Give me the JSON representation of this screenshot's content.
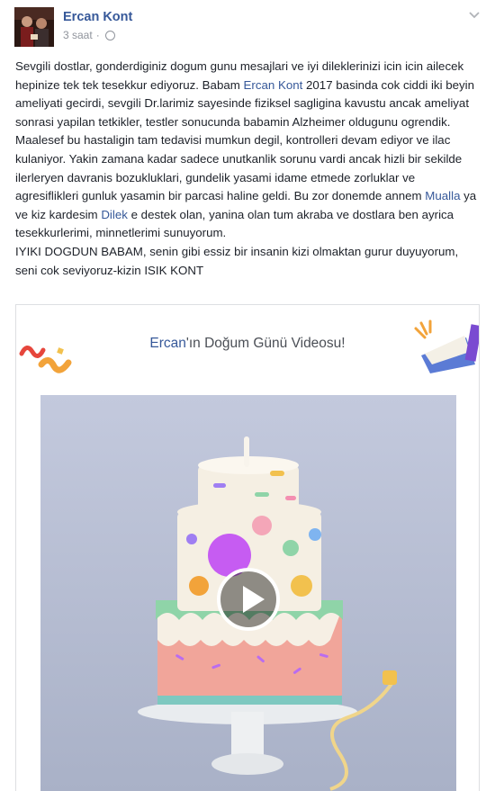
{
  "post": {
    "author": "Ercan Kont",
    "time": "3 saat",
    "time_separator": "·",
    "privacy_icon": "globe-icon",
    "options_icon": "chevron-down-icon",
    "paragraph": {
      "t1": "Sevgili dostlar, gonderdiginiz dogum gunu mesajlari ve iyi dileklerinizi icin icin ailecek hepinize tek tek tesekkur ediyoruz. Babam ",
      "mention_father": "Ercan Kont",
      "t2": " 2017 basinda cok ciddi iki beyin ameliyati gecirdi, sevgili Dr.larimiz sayesinde fiziksel sagligina kavustu ancak ameliyat sonrasi yapilan tetkikler, testler sonucunda babamin Alzheimer oldugunu ogrendik. Maalesef bu hastaligin tam tedavisi mumkun degil, kontrolleri devam ediyor ve ilac kulaniyor. Yakin zamana kadar sadece unutkanlik sorunu vardi ancak hizli bir sekilde ilerleryen davranis bozukluklari, gundelik yasami idame etmede zorluklar ve agresiflikleri gunluk yasamin bir parcasi haline geldi. Bu zor donemde annem ",
      "mention_mother": "Mualla",
      "t3": " ya ve kiz kardesim ",
      "mention_sister": "Dilek",
      "t4": " e destek olan, yanina olan tum akraba ve dostlara ben ayrica tesekkurlerimi, minnetlerimi sunuyorum.",
      "t5": "IYIKI DOGDUN BABAM, senin gibi essiz bir insanin kizi olmaktan gurur duyuyorum, seni cok seviyoruz-kizin ISIK KONT"
    }
  },
  "card": {
    "title_name": "Ercan",
    "title_rest": "'ın Doğum Günü Videosu!",
    "play_icon": "play-icon"
  },
  "colors": {
    "link": "#365899",
    "meta": "#90949c",
    "text": "#1d2129"
  }
}
